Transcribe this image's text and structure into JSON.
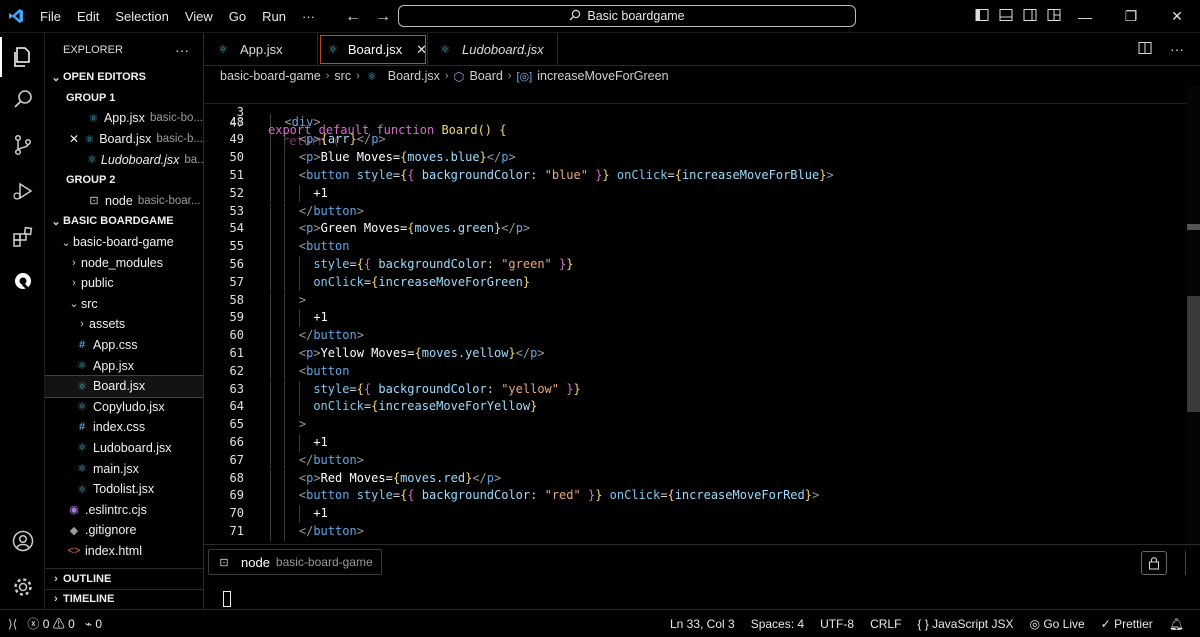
{
  "titlebar": {
    "menu": [
      "File",
      "Edit",
      "Selection",
      "View",
      "Go",
      "Run",
      "···"
    ],
    "search_text": "Basic boardgame"
  },
  "sidebar": {
    "title": "EXPLORER",
    "more": "···",
    "open_editors": "OPEN EDITORS",
    "group1": "GROUP 1",
    "group1_files": [
      {
        "name": "App.jsx",
        "desc": "basic-bo..."
      },
      {
        "name": "Board.jsx",
        "desc": "basic-b..."
      },
      {
        "name": "Ludoboard.jsx",
        "desc": "ba..."
      }
    ],
    "group2": "GROUP 2",
    "group2_files": [
      {
        "name": "node",
        "desc": "basic-boar..."
      }
    ],
    "workspace": "BASIC BOARDGAME",
    "tree": [
      {
        "name": "basic-board-game"
      },
      {
        "name": "node_modules"
      },
      {
        "name": "public"
      },
      {
        "name": "src"
      },
      {
        "name": "assets"
      },
      {
        "name": "App.css"
      },
      {
        "name": "App.jsx"
      },
      {
        "name": "Board.jsx"
      },
      {
        "name": "Copyludo.jsx"
      },
      {
        "name": "index.css"
      },
      {
        "name": "Ludoboard.jsx"
      },
      {
        "name": "main.jsx"
      },
      {
        "name": "Todolist.jsx"
      },
      {
        "name": ".eslintrc.cjs"
      },
      {
        "name": ".gitignore"
      },
      {
        "name": "index.html"
      }
    ],
    "outline": "OUTLINE",
    "timeline": "TIMELINE"
  },
  "tabs": [
    {
      "label": "App.jsx"
    },
    {
      "label": "Board.jsx"
    },
    {
      "label": "Ludoboard.jsx"
    }
  ],
  "breadcrumb": {
    "parts": [
      "basic-board-game",
      "src",
      "Board.jsx",
      "Board",
      "increaseMoveForGreen"
    ]
  },
  "editor": {
    "sticky": {
      "ln": "3",
      "kw1": "export",
      "kw2": "default",
      "kw3": "function",
      "name": "Board",
      "tail": "() {"
    },
    "partial": {
      "ln": "47",
      "text": "return ("
    },
    "lines": [
      {
        "ln": "48",
        "indent": 2,
        "tokens": [
          [
            "pun",
            "<"
          ],
          [
            "tag",
            "div"
          ],
          [
            "pun",
            ">"
          ]
        ]
      },
      {
        "ln": "49",
        "indent": 3,
        "tokens": [
          [
            "pun",
            "<"
          ],
          [
            "tag",
            "p"
          ],
          [
            "pun",
            ">"
          ],
          [
            "brace",
            "{"
          ],
          [
            "vr",
            "arr"
          ],
          [
            "brace",
            "}"
          ],
          [
            "pun",
            "</"
          ],
          [
            "tag",
            "p"
          ],
          [
            "pun",
            ">"
          ]
        ]
      },
      {
        "ln": "50",
        "indent": 3,
        "tokens": [
          [
            "pun",
            "<"
          ],
          [
            "tag",
            "p"
          ],
          [
            "pun",
            ">"
          ],
          [
            "txt",
            "Blue Moves="
          ],
          [
            "brace",
            "{"
          ],
          [
            "vr",
            "moves.blue"
          ],
          [
            "brace",
            "}"
          ],
          [
            "pun",
            "</"
          ],
          [
            "tag",
            "p"
          ],
          [
            "pun",
            ">"
          ]
        ]
      },
      {
        "ln": "51",
        "indent": 3,
        "tokens": [
          [
            "pun",
            "<"
          ],
          [
            "tag",
            "button"
          ],
          [
            "txt",
            " "
          ],
          [
            "attr",
            "style"
          ],
          [
            "ptr",
            "="
          ],
          [
            "brace",
            "{"
          ],
          [
            "brace2",
            "{"
          ],
          [
            "txt",
            " "
          ],
          [
            "vr",
            "backgroundColor"
          ],
          [
            "ptr",
            ": "
          ],
          [
            "str",
            "\"blue\""
          ],
          [
            "txt",
            " "
          ],
          [
            "brace2",
            "}"
          ],
          [
            "brace",
            "}"
          ],
          [
            "txt",
            " "
          ],
          [
            "attr",
            "onClick"
          ],
          [
            "ptr",
            "="
          ],
          [
            "brace",
            "{"
          ],
          [
            "vr",
            "increaseMoveForBlue"
          ],
          [
            "brace",
            "}"
          ],
          [
            "pun",
            ">"
          ]
        ]
      },
      {
        "ln": "52",
        "indent": 4,
        "tokens": [
          [
            "txt",
            "+1"
          ]
        ]
      },
      {
        "ln": "53",
        "indent": 3,
        "tokens": [
          [
            "pun",
            "</"
          ],
          [
            "tag",
            "button"
          ],
          [
            "pun",
            ">"
          ]
        ]
      },
      {
        "ln": "54",
        "indent": 3,
        "tokens": [
          [
            "pun",
            "<"
          ],
          [
            "tag",
            "p"
          ],
          [
            "pun",
            ">"
          ],
          [
            "txt",
            "Green Moves="
          ],
          [
            "brace",
            "{"
          ],
          [
            "vr",
            "moves.green"
          ],
          [
            "brace",
            "}"
          ],
          [
            "pun",
            "</"
          ],
          [
            "tag",
            "p"
          ],
          [
            "pun",
            ">"
          ]
        ]
      },
      {
        "ln": "55",
        "indent": 3,
        "tokens": [
          [
            "pun",
            "<"
          ],
          [
            "tag",
            "button"
          ]
        ]
      },
      {
        "ln": "56",
        "indent": 4,
        "tokens": [
          [
            "attr",
            "style"
          ],
          [
            "ptr",
            "="
          ],
          [
            "brace",
            "{"
          ],
          [
            "brace2",
            "{"
          ],
          [
            "txt",
            " "
          ],
          [
            "vr",
            "backgroundColor"
          ],
          [
            "ptr",
            ": "
          ],
          [
            "str",
            "\"green\""
          ],
          [
            "txt",
            " "
          ],
          [
            "brace2",
            "}"
          ],
          [
            "brace",
            "}"
          ]
        ]
      },
      {
        "ln": "57",
        "indent": 4,
        "tokens": [
          [
            "attr",
            "onClick"
          ],
          [
            "ptr",
            "="
          ],
          [
            "brace",
            "{"
          ],
          [
            "vr",
            "increaseMoveForGreen"
          ],
          [
            "brace",
            "}"
          ]
        ]
      },
      {
        "ln": "58",
        "indent": 3,
        "tokens": [
          [
            "pun",
            ">"
          ]
        ]
      },
      {
        "ln": "59",
        "indent": 4,
        "tokens": [
          [
            "txt",
            "+1"
          ]
        ]
      },
      {
        "ln": "60",
        "indent": 3,
        "tokens": [
          [
            "pun",
            "</"
          ],
          [
            "tag",
            "button"
          ],
          [
            "pun",
            ">"
          ]
        ]
      },
      {
        "ln": "61",
        "indent": 3,
        "tokens": [
          [
            "pun",
            "<"
          ],
          [
            "tag",
            "p"
          ],
          [
            "pun",
            ">"
          ],
          [
            "txt",
            "Yellow Moves="
          ],
          [
            "brace",
            "{"
          ],
          [
            "vr",
            "moves.yellow"
          ],
          [
            "brace",
            "}"
          ],
          [
            "pun",
            "</"
          ],
          [
            "tag",
            "p"
          ],
          [
            "pun",
            ">"
          ]
        ]
      },
      {
        "ln": "62",
        "indent": 3,
        "tokens": [
          [
            "pun",
            "<"
          ],
          [
            "tag",
            "button"
          ]
        ]
      },
      {
        "ln": "63",
        "indent": 4,
        "tokens": [
          [
            "attr",
            "style"
          ],
          [
            "ptr",
            "="
          ],
          [
            "brace",
            "{"
          ],
          [
            "brace2",
            "{"
          ],
          [
            "txt",
            " "
          ],
          [
            "vr",
            "backgroundColor"
          ],
          [
            "ptr",
            ": "
          ],
          [
            "str",
            "\"yellow\""
          ],
          [
            "txt",
            " "
          ],
          [
            "brace2",
            "}"
          ],
          [
            "brace",
            "}"
          ]
        ]
      },
      {
        "ln": "64",
        "indent": 4,
        "tokens": [
          [
            "attr",
            "onClick"
          ],
          [
            "ptr",
            "="
          ],
          [
            "brace",
            "{"
          ],
          [
            "vr",
            "increaseMoveForYellow"
          ],
          [
            "brace",
            "}"
          ]
        ]
      },
      {
        "ln": "65",
        "indent": 3,
        "tokens": [
          [
            "pun",
            ">"
          ]
        ]
      },
      {
        "ln": "66",
        "indent": 4,
        "tokens": [
          [
            "txt",
            "+1"
          ]
        ]
      },
      {
        "ln": "67",
        "indent": 3,
        "tokens": [
          [
            "pun",
            "</"
          ],
          [
            "tag",
            "button"
          ],
          [
            "pun",
            ">"
          ]
        ]
      },
      {
        "ln": "68",
        "indent": 3,
        "tokens": [
          [
            "pun",
            "<"
          ],
          [
            "tag",
            "p"
          ],
          [
            "pun",
            ">"
          ],
          [
            "txt",
            "Red Moves="
          ],
          [
            "brace",
            "{"
          ],
          [
            "vr",
            "moves.red"
          ],
          [
            "brace",
            "}"
          ],
          [
            "pun",
            "</"
          ],
          [
            "tag",
            "p"
          ],
          [
            "pun",
            ">"
          ]
        ]
      },
      {
        "ln": "69",
        "indent": 3,
        "tokens": [
          [
            "pun",
            "<"
          ],
          [
            "tag",
            "button"
          ],
          [
            "txt",
            " "
          ],
          [
            "attr",
            "style"
          ],
          [
            "ptr",
            "="
          ],
          [
            "brace",
            "{"
          ],
          [
            "brace2",
            "{"
          ],
          [
            "txt",
            " "
          ],
          [
            "vr",
            "backgroundColor"
          ],
          [
            "ptr",
            ": "
          ],
          [
            "str",
            "\"red\""
          ],
          [
            "txt",
            " "
          ],
          [
            "brace2",
            "}"
          ],
          [
            "brace",
            "}"
          ],
          [
            "txt",
            " "
          ],
          [
            "attr",
            "onClick"
          ],
          [
            "ptr",
            "="
          ],
          [
            "brace",
            "{"
          ],
          [
            "vr",
            "increaseMoveForRed"
          ],
          [
            "brace",
            "}"
          ],
          [
            "pun",
            ">"
          ]
        ]
      },
      {
        "ln": "70",
        "indent": 4,
        "tokens": [
          [
            "txt",
            "+1"
          ]
        ]
      },
      {
        "ln": "71",
        "indent": 3,
        "tokens": [
          [
            "pun",
            "</"
          ],
          [
            "tag",
            "button"
          ],
          [
            "pun",
            ">"
          ]
        ]
      }
    ]
  },
  "panel": {
    "tab_label": "node",
    "tab_desc": "basic-board-game"
  },
  "statusbar": {
    "errors": "0",
    "warnings": "0",
    "ports": "0",
    "position": "Ln 33, Col 3",
    "spaces": "Spaces: 4",
    "encoding": "UTF-8",
    "eol": "CRLF",
    "language": "JavaScript JSX",
    "golive": "Go Live",
    "prettier": "Prettier"
  },
  "colors": {
    "accent": "#b74c2a",
    "keyword": "#d76cc9",
    "function": "#f2d774",
    "tag": "#5fa7e6",
    "string": "#e8a87c"
  }
}
